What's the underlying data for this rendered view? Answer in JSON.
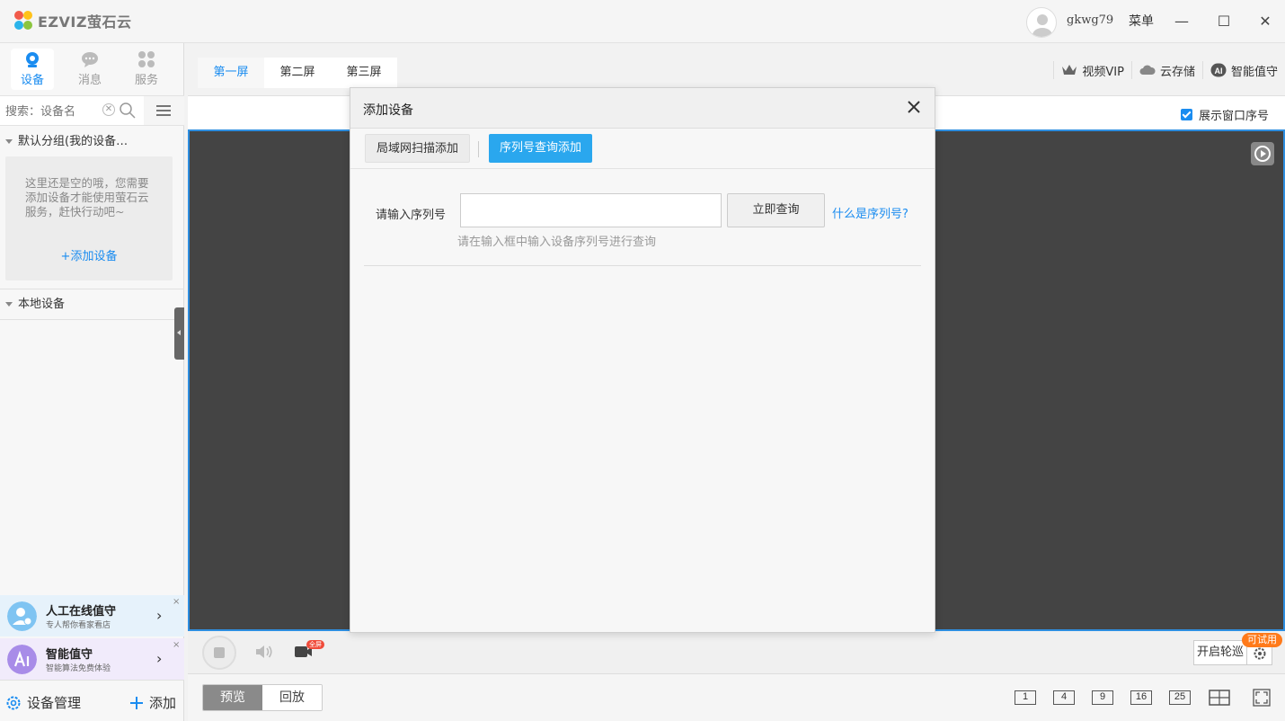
{
  "app": {
    "logo_text": "EZVIZ萤石云",
    "username": "gkwg79",
    "menu_label": "菜单",
    "minimize": "—",
    "maximize": "☐",
    "close": "✕"
  },
  "sidebar": {
    "tabs": [
      {
        "label": "设备",
        "icon": "camera-icon",
        "active": true
      },
      {
        "label": "消息",
        "icon": "chat-icon",
        "active": false
      },
      {
        "label": "服务",
        "icon": "grid-icon",
        "active": false
      }
    ],
    "search_placeholder": "搜索：设备名",
    "search_clear": "✕",
    "default_group": "默认分组(我的设备…",
    "empty_text": "这里还是空的哦，您需要添加设备才能使用萤石云服务，赶快行动吧~",
    "add_device": "+添加设备",
    "local_devices": "本地设备",
    "promos": [
      {
        "title": "人工在线值守",
        "subtitle": "专人帮你看家看店",
        "arrow": "›",
        "close": "×"
      },
      {
        "title": "智能值守",
        "subtitle": "智能算法免费体验",
        "arrow": "›",
        "close": "×"
      }
    ],
    "manage_label": "设备管理",
    "add_label": "添加"
  },
  "main": {
    "screen_tabs": [
      {
        "label": "第一屏",
        "active": true
      },
      {
        "label": "第二屏",
        "active": false
      },
      {
        "label": "第三屏",
        "active": false
      }
    ],
    "top_right": [
      {
        "label": "视频VIP",
        "icon": "crown-icon"
      },
      {
        "label": "云存储",
        "icon": "cloud-icon"
      },
      {
        "label": "智能值守",
        "icon": "ai-icon"
      }
    ],
    "show_index_label": "展示窗口序号",
    "fullscreen_badge": "全屏",
    "patrol_label": "开启轮巡",
    "trial_badge": "可试用",
    "mode_tabs": [
      {
        "label": "预览",
        "active": true
      },
      {
        "label": "回放",
        "active": false
      }
    ],
    "layouts": [
      "1",
      "4",
      "9",
      "16",
      "25"
    ]
  },
  "modal": {
    "title": "添加设备",
    "tab_lan": "局域网扫描添加",
    "tab_serial": "序列号查询添加",
    "serial_label": "请输入序列号",
    "serial_value": "",
    "query_button": "立即查询",
    "what_link": "什么是序列号?",
    "hint": "请在输入框中输入设备序列号进行查询"
  },
  "colors": {
    "accent": "#1a8cf0",
    "active_tab": "#2aa7ee",
    "video_bg": "#444444",
    "video_border": "#2e8ee0",
    "trial": "#ff7a1a"
  }
}
